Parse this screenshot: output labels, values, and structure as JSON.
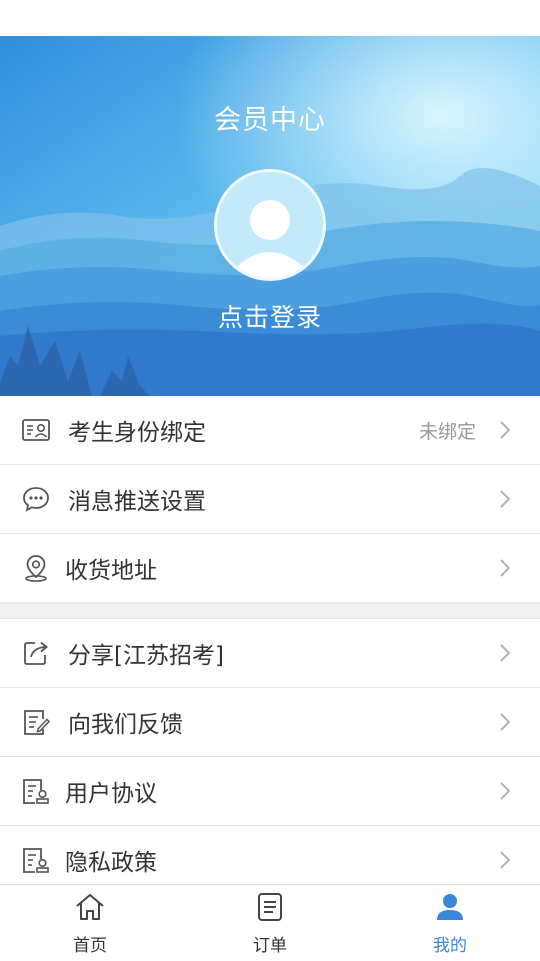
{
  "header": {
    "title": "会员中心",
    "login_text": "点击登录"
  },
  "menu_group_1": [
    {
      "label": "考生身份绑定",
      "value": "未绑定",
      "icon": "id-card-icon"
    },
    {
      "label": "消息推送设置",
      "value": "",
      "icon": "chat-bubble-icon"
    },
    {
      "label": "收货地址",
      "value": "",
      "icon": "location-pin-icon"
    }
  ],
  "menu_group_2": [
    {
      "label": "分享[江苏招考]",
      "icon": "share-icon"
    },
    {
      "label": "向我们反馈",
      "icon": "feedback-edit-icon"
    },
    {
      "label": "用户协议",
      "icon": "agreement-icon"
    },
    {
      "label": "隐私政策",
      "icon": "privacy-policy-icon"
    }
  ],
  "tabbar": {
    "tabs": [
      {
        "label": "首页",
        "icon": "home-icon"
      },
      {
        "label": "订单",
        "icon": "order-list-icon"
      },
      {
        "label": "我的",
        "icon": "user-icon"
      }
    ],
    "active_index": 2,
    "active_color": "#3a86d8",
    "inactive_color": "#333333"
  }
}
